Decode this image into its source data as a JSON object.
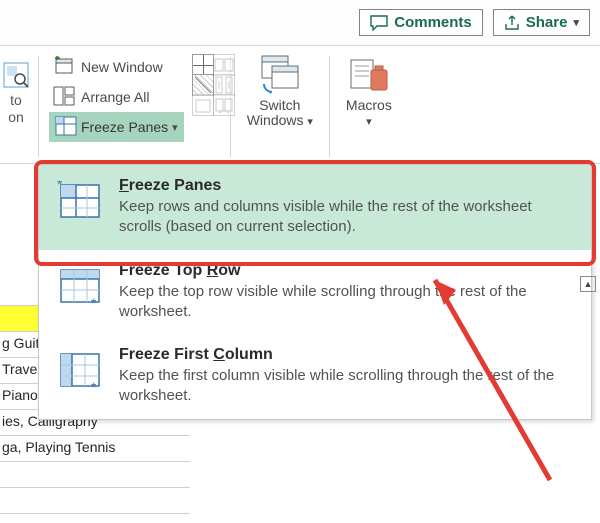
{
  "topbar": {
    "comments": "Comments",
    "share": "Share"
  },
  "ribbon": {
    "scrap_line1": "to",
    "scrap_line2": "on",
    "new_window": "New Window",
    "arrange_all": "Arrange All",
    "freeze_panes": "Freeze Panes",
    "switch_windows": "Switch\nWindows",
    "macros": "Macros"
  },
  "dropdown": {
    "items": [
      {
        "title": "Freeze Panes",
        "title_u": "F",
        "desc": "Keep rows and columns visible while the rest of the worksheet scrolls (based on current selection)."
      },
      {
        "title": "Freeze Top Row",
        "title_u": "R",
        "desc": "Keep the top row visible while scrolling through the rest of the worksheet."
      },
      {
        "title": "Freeze First Column",
        "title_u": "C",
        "desc": "Keep the first column visible while scrolling through the rest of the worksheet."
      }
    ]
  },
  "sheet": {
    "rows": [
      "g Guit",
      "Trave",
      "Piano",
      "ies, Calligraphy",
      "ga, Playing Tennis"
    ]
  },
  "icons": {
    "comment": "comment-icon",
    "share": "share-icon",
    "new_window": "new-window-icon",
    "arrange": "arrange-all-icon",
    "freeze": "freeze-panes-icon"
  },
  "colors": {
    "accent": "#1a6b4b",
    "highlight_border": "#e33b32",
    "selection_bg": "#c8e8d8",
    "freeze_btn_bg": "#a6d4be"
  }
}
